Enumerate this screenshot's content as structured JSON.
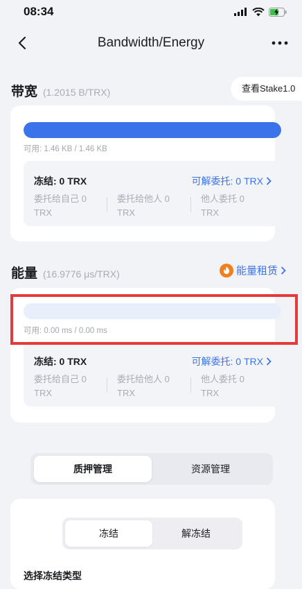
{
  "status_bar": {
    "time": "08:34"
  },
  "nav": {
    "title": "Bandwidth/Energy"
  },
  "bandwidth": {
    "title": "带宽",
    "rate": "(1.2015 B/TRX)",
    "stake_link": "查看Stake1.0",
    "usage_fraction": 1.0,
    "usage": "可用: 1.46 KB / 1.46 KB",
    "frozen": "冻结: 0 TRX",
    "undelegate": "可解委托: 0 TRX",
    "delegate_self": [
      "委托给自己 0",
      "TRX"
    ],
    "delegate_others": [
      "委托给他人 0",
      "TRX"
    ],
    "delegated_by_others": [
      "他人委托 0",
      "TRX"
    ]
  },
  "energy": {
    "title": "能量",
    "rate": "(16.9776 μs/TRX)",
    "rent_label": "能量租赁",
    "usage_fraction": 0.0,
    "usage": "可用: 0.00 ms / 0.00 ms",
    "frozen": "冻结: 0 TRX",
    "undelegate": "可解委托: 0 TRX",
    "delegate_self": [
      "委托给自己 0",
      "TRX"
    ],
    "delegate_others": [
      "委托给他人 0",
      "TRX"
    ],
    "delegated_by_others": [
      "他人委托 0",
      "TRX"
    ]
  },
  "manage_tabs": [
    {
      "label": "质押管理",
      "active": true
    },
    {
      "label": "资源管理",
      "active": false
    }
  ],
  "freeze_tabs": [
    {
      "label": "冻结",
      "active": true
    },
    {
      "label": "解冻结",
      "active": false
    }
  ],
  "select_type_label": "选择冻结类型",
  "colors": {
    "accent": "#3b74ea",
    "highlight": "#e5393a",
    "rent_icon": "#f07f1d"
  }
}
